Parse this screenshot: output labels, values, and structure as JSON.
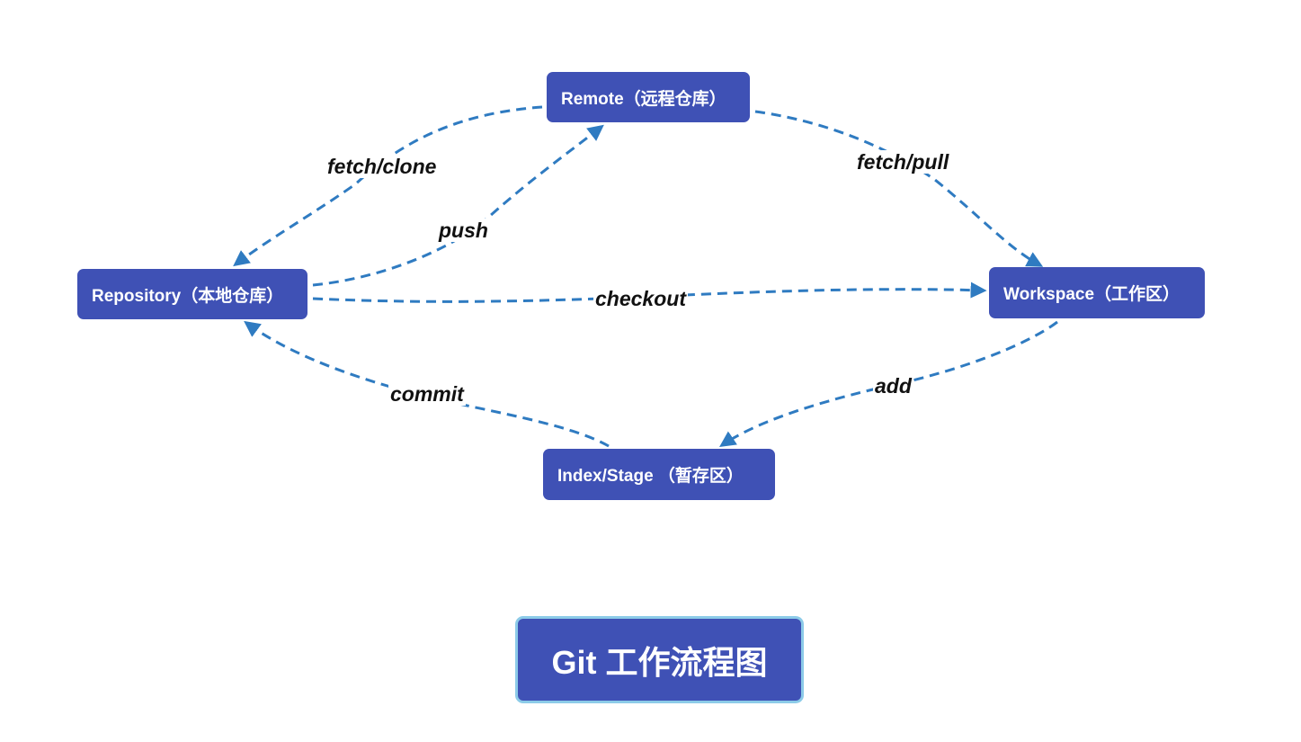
{
  "nodes": {
    "remote": "Remote（远程仓库）",
    "repository": "Repository（本地仓库）",
    "workspace": "Workspace（工作区）",
    "index": "Index/Stage （暂存区）"
  },
  "edges": {
    "fetch_clone": "fetch/clone",
    "push": "push",
    "fetch_pull": "fetch/pull",
    "checkout": "checkout",
    "commit": "commit",
    "add": "add"
  },
  "title": "Git 工作流程图",
  "colors": {
    "node_fill": "#3f51b5",
    "arrow": "#2f7bc1",
    "title_border": "#8ccbe8"
  }
}
